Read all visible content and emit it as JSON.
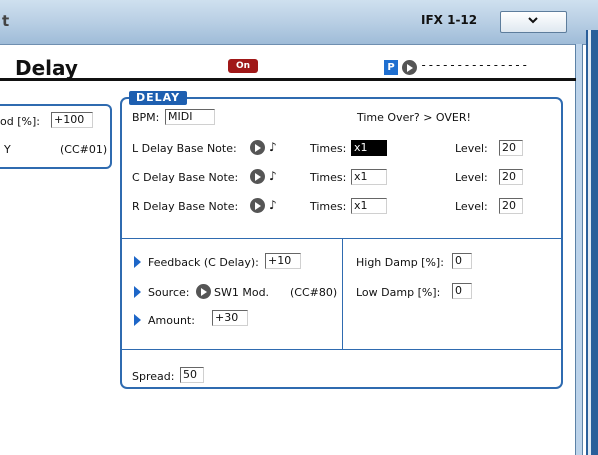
{
  "topbar": {
    "title_fragment": "t",
    "ifx_label": "IFX 1-12"
  },
  "header": {
    "title": "Delay",
    "on_label": "On",
    "p_label": "P",
    "dash_text": "---------------"
  },
  "left_panel": {
    "row1_label": "od [%]:",
    "row1_value": "+100",
    "row2_label": "Y",
    "row2_cc": "(CC#01)"
  },
  "delay": {
    "section_tag": "DELAY",
    "bpm_label": "BPM:",
    "bpm_value": "MIDI",
    "time_over": "Time Over? > OVER!",
    "rows": [
      {
        "label": "L Delay Base Note:",
        "times_label": "Times:",
        "times_value": "x1",
        "level_label": "Level:",
        "level_value": "20"
      },
      {
        "label": "C Delay Base Note:",
        "times_label": "Times:",
        "times_value": "x1",
        "level_label": "Level:",
        "level_value": "20"
      },
      {
        "label": "R Delay Base Note:",
        "times_label": "Times:",
        "times_value": "x1",
        "level_label": "Level:",
        "level_value": "20"
      }
    ],
    "note_symbol": "♪",
    "feedback_label": "Feedback (C Delay):",
    "feedback_value": "+10",
    "source_label": "Source:",
    "source_value": "SW1 Mod.",
    "source_cc": "(CC#80)",
    "amount_label": "Amount:",
    "amount_value": "+30",
    "high_damp_label": "High Damp [%]:",
    "high_damp_value": "0",
    "low_damp_label": "Low Damp [%]:",
    "low_damp_value": "0",
    "spread_label": "Spread:",
    "spread_value": "50"
  },
  "colors": {
    "accent_blue": "#2f6bb0",
    "on_red": "#a01818",
    "p_blue": "#1f6fd0"
  }
}
